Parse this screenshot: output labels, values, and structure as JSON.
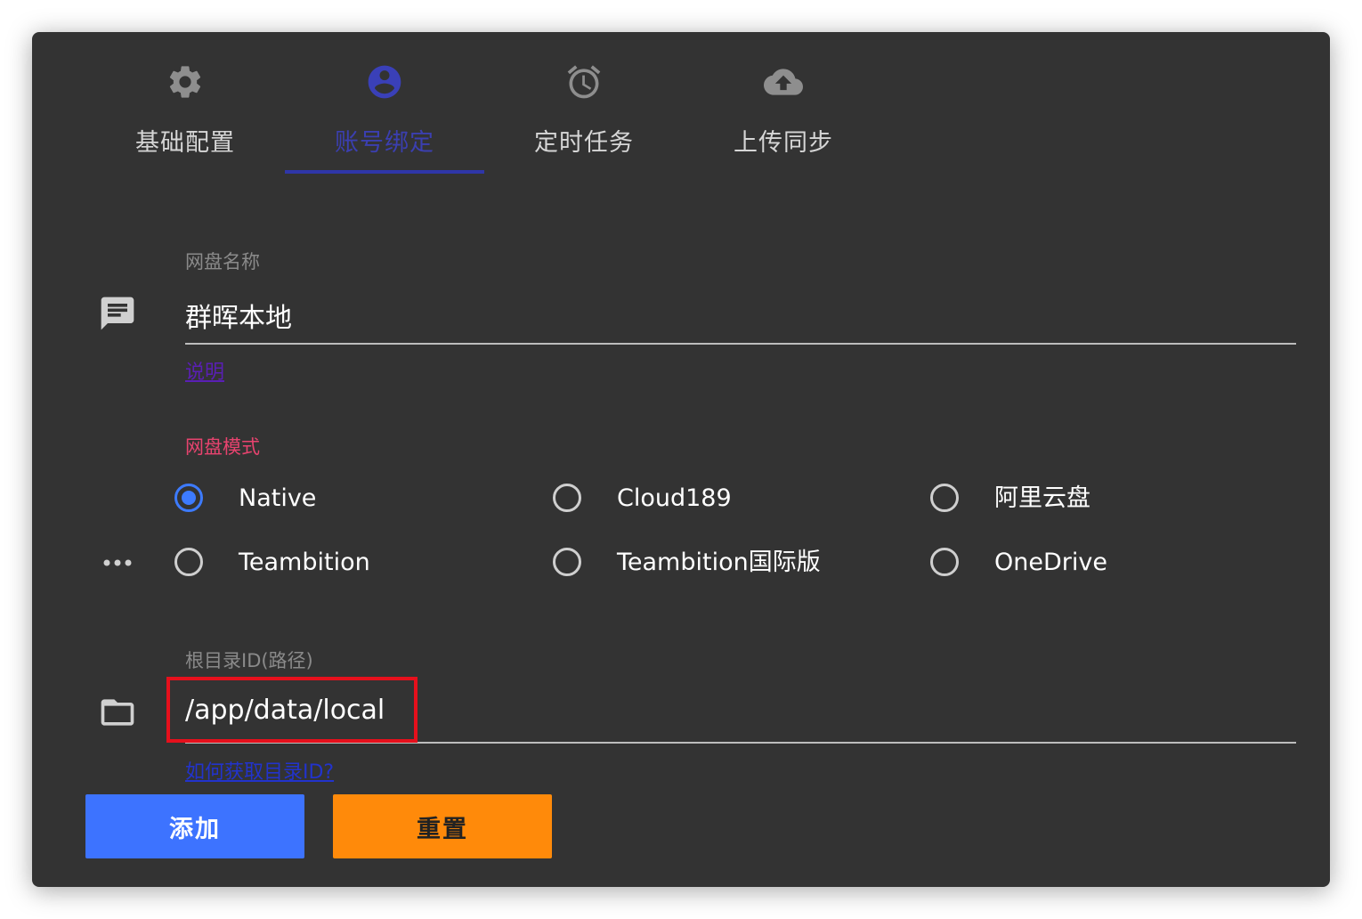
{
  "tabs": [
    {
      "label": "基础配置",
      "icon": "gear-icon",
      "active": false
    },
    {
      "label": "账号绑定",
      "icon": "account-circle-icon",
      "active": true
    },
    {
      "label": "定时任务",
      "icon": "alarm-clock-icon",
      "active": false
    },
    {
      "label": "上传同步",
      "icon": "cloud-upload-icon",
      "active": false
    }
  ],
  "form": {
    "name_field": {
      "label": "网盘名称",
      "value": "群晖本地",
      "icon": "message-icon",
      "help": "说明"
    },
    "mode_field": {
      "label": "网盘模式",
      "icon": "more-horiz-icon",
      "options": [
        "Native",
        "Cloud189",
        "阿里云盘",
        "Teambition",
        "Teambition国际版",
        "OneDrive"
      ],
      "selected": "Native"
    },
    "root_field": {
      "label": "根目录ID(路径)",
      "value": "/app/data/local",
      "icon": "folder-icon",
      "help": "如何获取目录ID? "
    }
  },
  "buttons": {
    "add_label": "添加",
    "reset_label": "重置"
  },
  "colors": {
    "background": "#333333",
    "accent_tab": "#2f36a8",
    "radio_selected": "#3d7bff",
    "mode_label": "#e8436f",
    "add_button": "#3d73ff",
    "reset_button": "#ff8a0a",
    "highlight": "#e6101c"
  }
}
